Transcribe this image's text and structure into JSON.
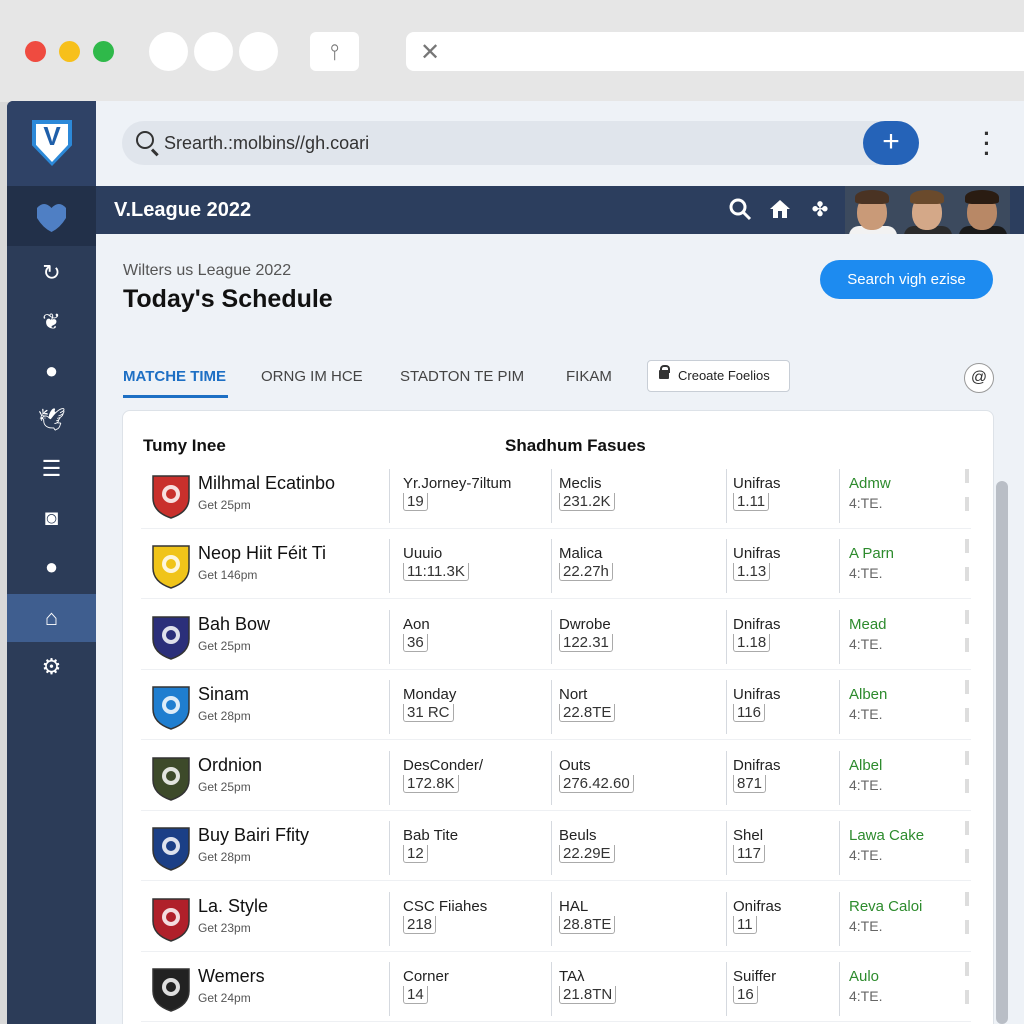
{
  "browser": {
    "close_symbol": "✕"
  },
  "search": {
    "text": "Srearth.:molbins//gh.coari",
    "plus_label": "+"
  },
  "header": {
    "title": "V.League 2022"
  },
  "page": {
    "breadcrumb": "Wilters us League 2022",
    "title": "Today's Schedule",
    "primary_button": "Search vigh ezise"
  },
  "tabs": [
    {
      "label": "MATCHE TIME",
      "active": true
    },
    {
      "label": "ORNG IM HCE",
      "active": false
    },
    {
      "label": "STADTON TE PIM",
      "active": false
    },
    {
      "label": "FIKAM",
      "active": false
    }
  ],
  "create_button": "Creoate Foelios",
  "at_button": "@",
  "table": {
    "headers": [
      "Tumy Inee",
      "Shadhum Fasues"
    ],
    "rows": [
      {
        "team": "Milhmal Ecatinbo",
        "time": "Get 25pm",
        "c1_top": "Yr.Jorney-7iltum",
        "c1_bot": "19",
        "c2_top": "Meclis",
        "c2_bot": "231.2K",
        "c3_top": "Unifras",
        "c3_bot": "1.11",
        "c4_top": "Admw",
        "c4_bot": "4:TE.",
        "badge": "#c9302c"
      },
      {
        "team": "Neop Hiit Féit Ti",
        "time": "Get 146pm",
        "c1_top": "Uuuio",
        "c1_bot": "11:11.3K",
        "c2_top": "Malica",
        "c2_bot": "22.27h",
        "c3_top": "Unifras",
        "c3_bot": "1.13",
        "c4_top": "A Parn",
        "c4_bot": "4:TE.",
        "badge": "#f0c419"
      },
      {
        "team": "Bah Bow",
        "time": "Get 25pm",
        "c1_top": "Aon",
        "c1_bot": "36",
        "c2_top": "Dwrobe",
        "c2_bot": "122.31",
        "c3_top": "Dnifras",
        "c3_bot": "1.18",
        "c4_top": "Mead",
        "c4_bot": "4:TE.",
        "badge": "#2b2f7a"
      },
      {
        "team": "Sinam",
        "time": "Get 28pm",
        "c1_top": "Monday",
        "c1_bot": "31 RC",
        "c2_top": "Nort",
        "c2_bot": "22.8TE",
        "c3_top": "Unifras",
        "c3_bot": "116",
        "c4_top": "Alben",
        "c4_bot": "4:TE.",
        "badge": "#1f7ed0"
      },
      {
        "team": "Ordnion",
        "time": "Get 25pm",
        "c1_top": "DesConder/",
        "c1_bot": "172.8K",
        "c2_top": "Outs",
        "c2_bot": "276.42.60",
        "c3_top": "Dnifras",
        "c3_bot": "871",
        "c4_top": "Albel",
        "c4_bot": "4:TE.",
        "badge": "#3d4a2a"
      },
      {
        "team": "Buy Bairi Ffity",
        "time": "Get 28pm",
        "c1_top": "Bab Tite",
        "c1_bot": "12",
        "c2_top": "Beuls",
        "c2_bot": "22.29E",
        "c3_top": "Shel",
        "c3_bot": "117",
        "c4_top": "Lawa Cake",
        "c4_bot": "4:TE.",
        "badge": "#1b3f86"
      },
      {
        "team": "La. Style",
        "time": "Get 23pm",
        "c1_top": "CSC Fiiahes",
        "c1_bot": "218",
        "c2_top": "HAL",
        "c2_bot": "28.8TE",
        "c3_top": "Onifras",
        "c3_bot": "11",
        "c4_top": "Reva Caloi",
        "c4_bot": "4:TE.",
        "badge": "#b0202a"
      },
      {
        "team": "Wemers",
        "time": "Get 24pm",
        "c1_top": "Corner",
        "c1_bot": "14",
        "c2_top": "TAλ",
        "c2_bot": "21.8TN",
        "c3_top": "Suiffer",
        "c3_bot": "16",
        "c4_top": "Aulo",
        "c4_bot": "4:TE.",
        "badge": "#222222"
      }
    ]
  },
  "colors": {
    "sidebar": "#2c3c58",
    "header_band": "#2c3e5e",
    "accent_blue": "#1d8bf0",
    "tab_active": "#1d6fc4",
    "green_text": "#2d8b2d"
  },
  "icons": [
    "search-icon",
    "home-icon",
    "settings-icon",
    "user-icon",
    "twitter-icon",
    "list-icon",
    "instagram-icon",
    "lock-icon",
    "kebab-menu-icon",
    "close-icon"
  ]
}
